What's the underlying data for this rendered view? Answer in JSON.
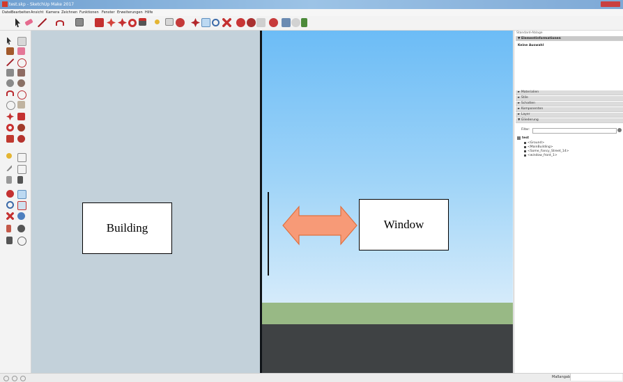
{
  "window": {
    "title": "test.skp - SketchUp Make 2017"
  },
  "menu": [
    "Datei",
    "Bearbeiten",
    "Ansicht",
    "Kamera",
    "Zeichnen",
    "Funktionen",
    "Fenster",
    "Erweiterungen",
    "Hilfe"
  ],
  "scene": {
    "building_label": "Building",
    "window_label": "Window"
  },
  "panel": {
    "tray_title": "Standard-Ablage",
    "entity_info": "Elementinformationen",
    "no_selection": "Keine Auswahl",
    "sections": [
      "Materialien",
      "Stile",
      "Schatten",
      "Komponenten",
      "Layer",
      "Gliederung"
    ],
    "filter_label": "Filter:",
    "outliner_root": "test",
    "outliner_items": [
      "<Ground>",
      "<MainBuilding>",
      "<Some_Fancy_Street_14>",
      "<window_front_1>"
    ]
  },
  "status": {
    "measurements_label": "Maßangaben"
  },
  "colors": {
    "sky": "#6cbcf6",
    "grass": "#98b985",
    "ground": "#3f4244",
    "building": "#c3d1da",
    "arrow_fill": "#f79a77",
    "arrow_stroke": "#e0703f"
  },
  "icons": [
    "select-icon",
    "eraser-icon",
    "line-icon",
    "arc-icon",
    "rectangle-icon",
    "push-pull-icon",
    "move-icon",
    "rotate-icon",
    "offset-icon",
    "tape-measure-icon",
    "text-icon",
    "paint-bucket-icon",
    "orbit-icon",
    "pan-icon",
    "zoom-icon",
    "zoom-extents-icon"
  ]
}
